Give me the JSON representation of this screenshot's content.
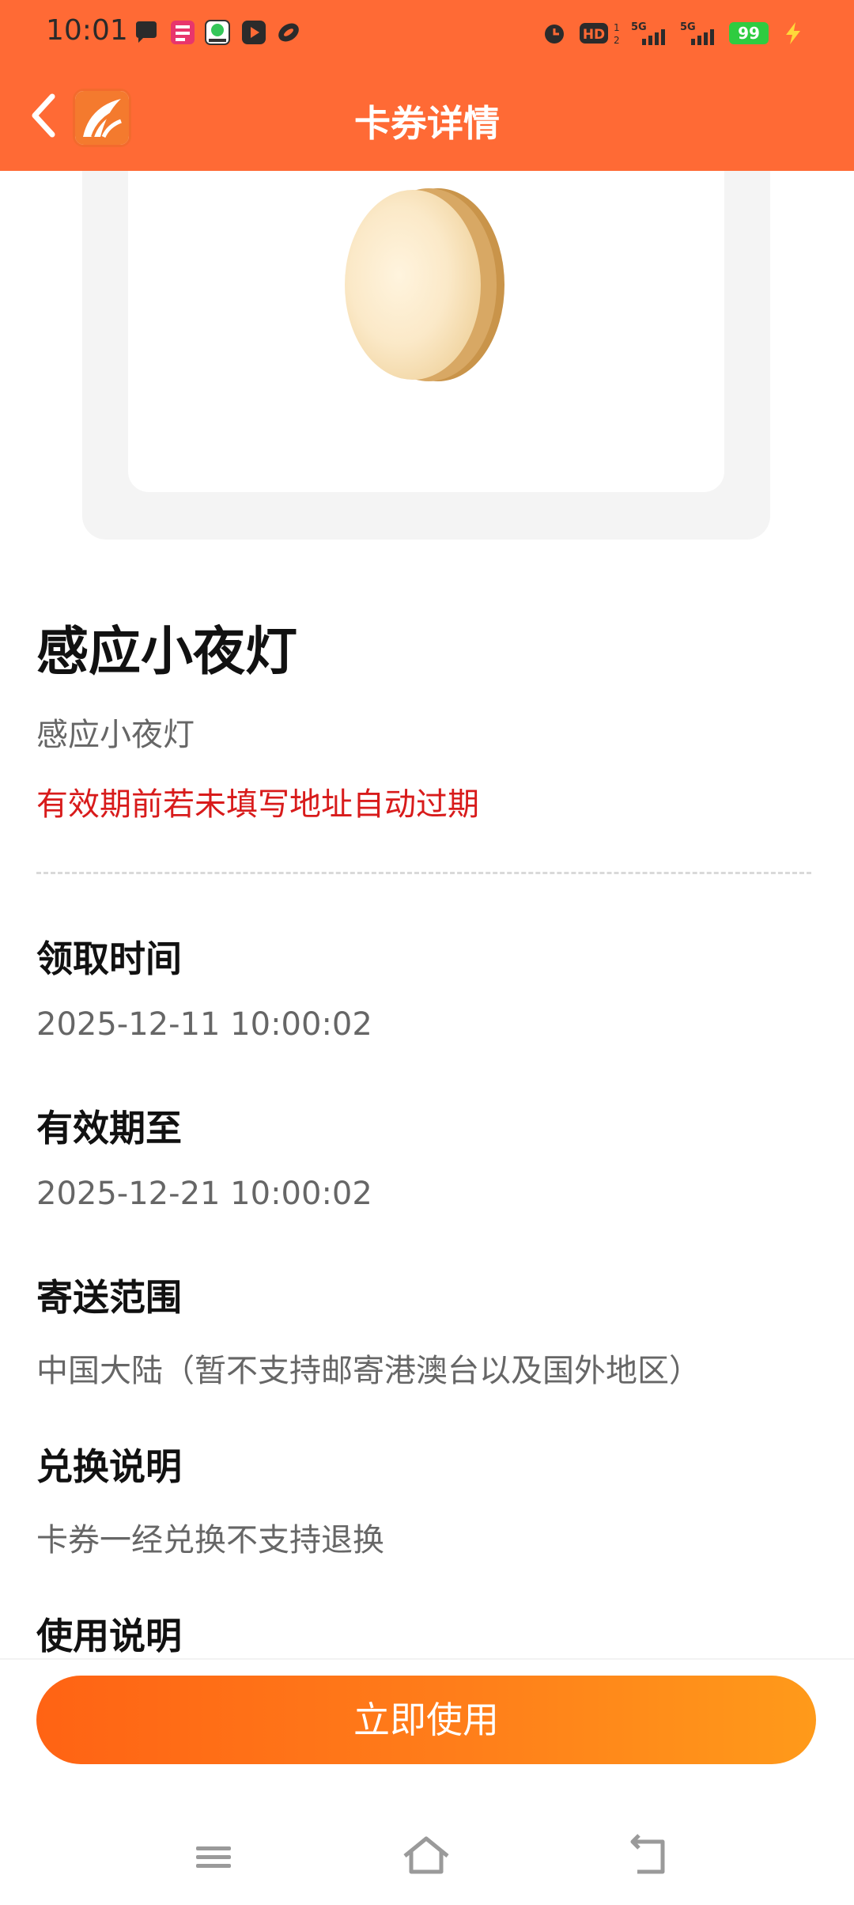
{
  "status_bar": {
    "time": "10:01",
    "battery": "99",
    "icons": [
      "chat-bubble-icon",
      "app-notification-icon",
      "video-app-icon",
      "play-icon",
      "link-icon",
      "alarm-icon",
      "hd-icon",
      "signal-5g-icon",
      "signal-5g-icon",
      "battery-icon",
      "charging-icon"
    ]
  },
  "header": {
    "title": "卡券详情"
  },
  "product": {
    "title": "感应小夜灯",
    "subtitle": "感应小夜灯",
    "warning": "有效期前若未填写地址自动过期"
  },
  "details": [
    {
      "label": "领取时间",
      "value": "2025-12-11 10:00:02"
    },
    {
      "label": "有效期至",
      "value": "2025-12-21 10:00:02"
    },
    {
      "label": "寄送范围",
      "value": "中国大陆（暂不支持邮寄港澳台以及国外地区）"
    },
    {
      "label": "兑换说明",
      "value": "卡券一经兑换不支持退换"
    },
    {
      "label": "使用说明",
      "value": ""
    }
  ],
  "actions": {
    "use_label": "立即使用"
  },
  "colors": {
    "header": "#FF6A35",
    "warning": "#D81B1B",
    "button_start": "#FF6314",
    "button_end": "#FF9A1A"
  }
}
